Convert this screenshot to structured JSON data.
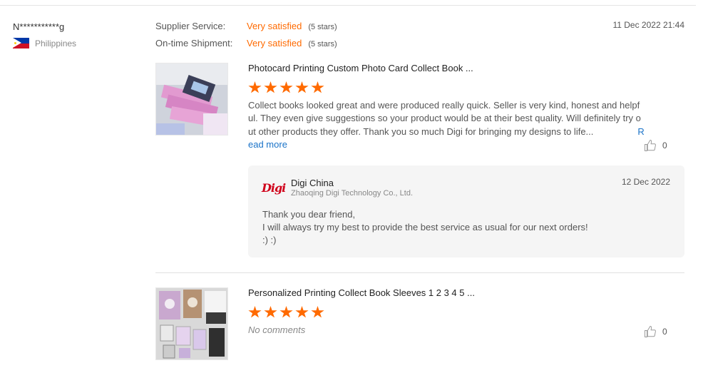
{
  "buyer": {
    "name": "N***********g",
    "country": "Philippines",
    "flag_icon": "philippines-flag-icon"
  },
  "ratings": [
    {
      "label": "Supplier Service:",
      "value": "Very satisfied",
      "stars_text": "(5 stars)"
    },
    {
      "label": "On-time Shipment:",
      "value": "Very satisfied",
      "stars_text": "(5 stars)"
    }
  ],
  "review_date": "11 Dec 2022 21:44",
  "colors": {
    "accent": "#ff6a00",
    "link": "#1a73c8",
    "reply_bg": "#f5f5f5",
    "logo": "#d0021b"
  },
  "products": [
    {
      "title": "Photocard Printing Custom Photo Card Collect Book ...",
      "stars": 5,
      "review": "Collect books looked great and were produced really quick. Seller is very kind, honest and helpful. They even give suggestions so your product would be at their best quality. Will definitely try out other products they offer. Thank you so much Digi for bringing my designs to life...",
      "read_more": "Read more",
      "likes": "0",
      "like_icon": "thumbs-up-icon"
    },
    {
      "title": "Personalized Printing Collect Book Sleeves 1 2 3 4 5 ...",
      "stars": 5,
      "no_comments": "No comments",
      "likes": "0",
      "like_icon": "thumbs-up-icon"
    }
  ],
  "reply": {
    "logo_text": "Digi",
    "seller_name": "Digi China",
    "company": "Zhaoqing Digi Technology Co., Ltd.",
    "date": "12 Dec 2022",
    "lines": [
      "Thank you dear friend,",
      "I will always try my best to provide the best service as usual for our next orders!",
      ":) :)"
    ]
  }
}
